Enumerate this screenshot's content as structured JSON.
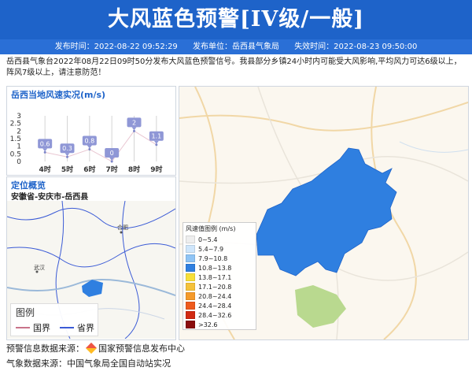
{
  "header": {
    "title": "大风蓝色预警[IV级/一般]",
    "publish_time": "发布时间：2022-08-22 09:52:29",
    "publisher": "发布单位：岳西县气象局",
    "expire_time": "失效时间：2022-08-23 09:50:00"
  },
  "description": "岳西县气象台2022年08月22日09时50分发布大风蓝色预警信号。我县部分乡镇24小时内可能受大风影响,平均风力可达6级以上，阵风7级以上，请注意防范！",
  "wind_panel": {
    "title": "岳西当地风速实况(m/s)"
  },
  "location_panel": {
    "title": "定位概览",
    "subtitle": "安徽省-安庆市-岳西县"
  },
  "map_labels": {
    "hefei": "合肥",
    "wuhan": "武汉"
  },
  "chart_data": {
    "type": "line",
    "categories": [
      "4时",
      "5时",
      "6时",
      "7时",
      "8时",
      "9时"
    ],
    "values": [
      0.6,
      0.3,
      0.8,
      0,
      2,
      1.1
    ],
    "ylim": [
      0,
      3
    ],
    "yticks": [
      "0",
      "0.5",
      "1",
      "1.5",
      "2",
      "2.5",
      "3"
    ],
    "title": "岳西当地风速实况(m/s)"
  },
  "legend": {
    "title": "风速值图例 (m/s)",
    "items": [
      {
        "label": "0~5.4",
        "color": "#eeeeee"
      },
      {
        "label": "5.4~7.9",
        "color": "#cfe6fb"
      },
      {
        "label": "7.9~10.8",
        "color": "#8fc4f5"
      },
      {
        "label": "10.8~13.8",
        "color": "#2f7fe0"
      },
      {
        "label": "13.8~17.1",
        "color": "#f7e03a"
      },
      {
        "label": "17.1~20.8",
        "color": "#f5c23a"
      },
      {
        "label": "20.8~24.4",
        "color": "#f59a2a"
      },
      {
        "label": "24.4~28.4",
        "color": "#ee5a1c"
      },
      {
        "label": "28.4~32.6",
        "color": "#d12a12"
      },
      {
        "label": ">32.6",
        "color": "#8a0c0c"
      }
    ]
  },
  "map_legend": {
    "title": "图例",
    "country": "国界",
    "province": "省界",
    "country_color": "#c9738a",
    "province_color": "#3b5bd6"
  },
  "sources": {
    "warning_label": "预警信息数据来源：",
    "warning_value": "国家预警信息发布中心",
    "weather": "气象数据来源：中国气象局全国自动站实况"
  },
  "colors": {
    "header": "#1e63c9",
    "accent": "#1e63c9",
    "area": "#2f7fe0"
  }
}
